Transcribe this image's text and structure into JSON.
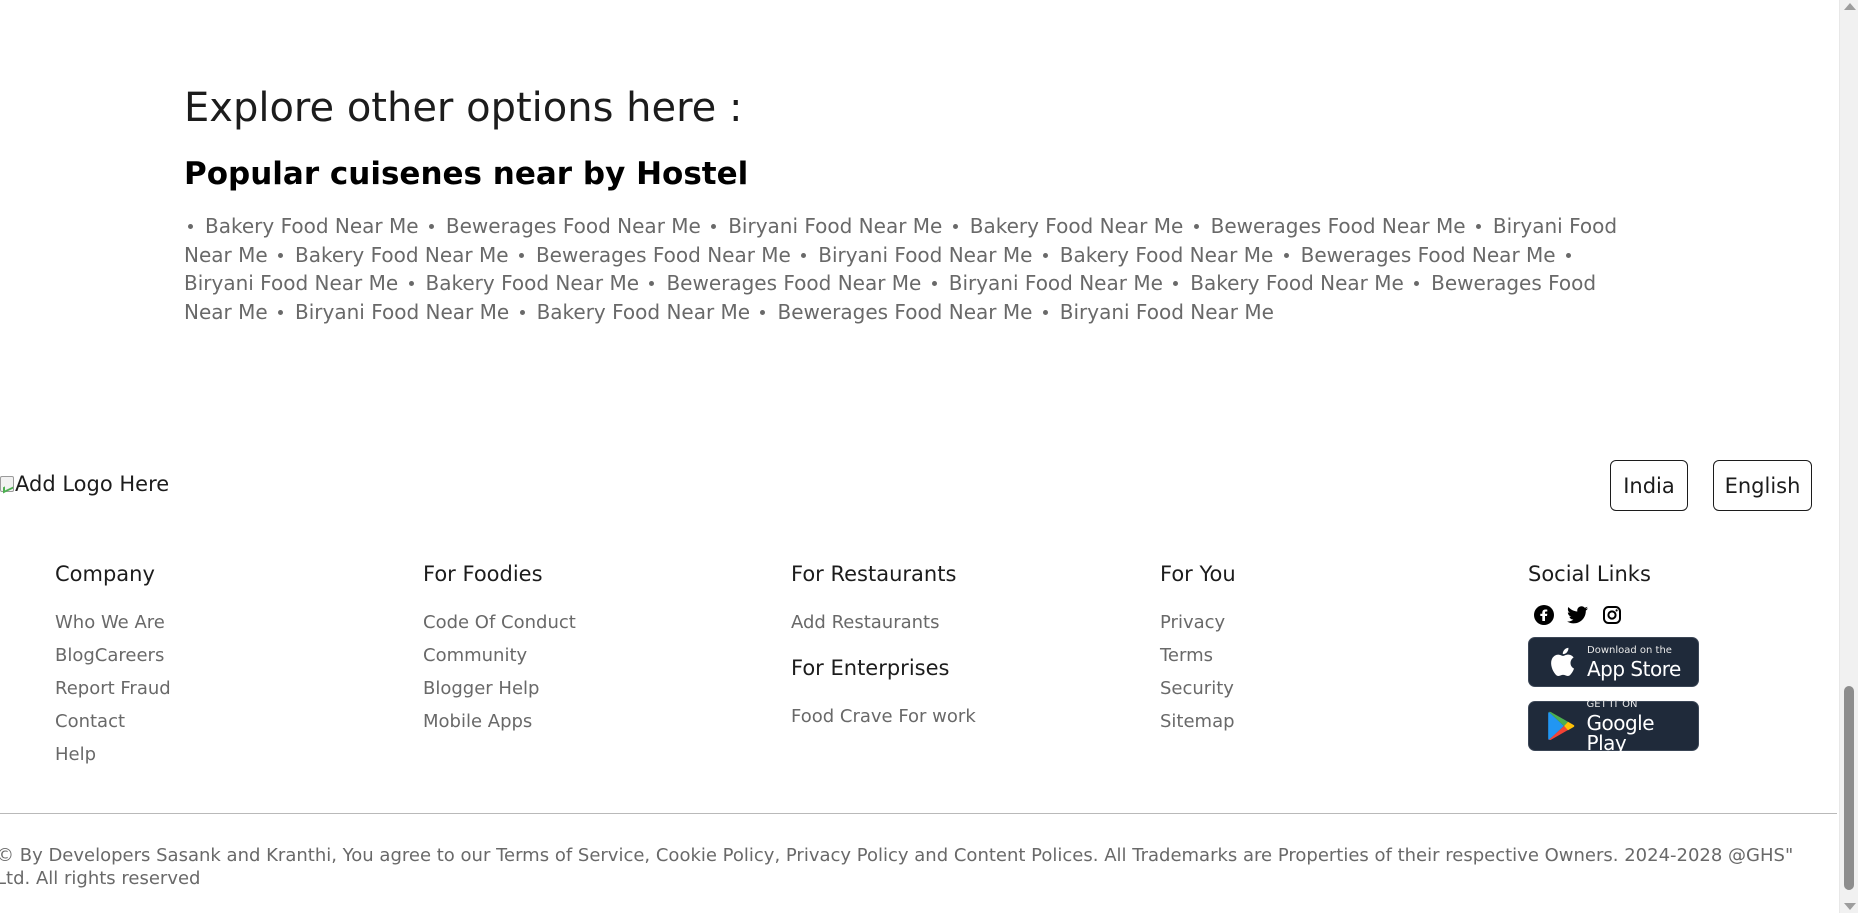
{
  "explore": {
    "title": "Explore other options here :",
    "cuisine_heading": "Popular cuisenes near by Hostel",
    "cuisines": [
      "Bakery Food Near Me",
      "Bewerages Food Near Me",
      "Biryani Food Near Me",
      "Bakery Food Near Me",
      "Bewerages Food Near Me",
      "Biryani Food Near Me",
      "Bakery Food Near Me",
      "Bewerages Food Near Me",
      "Biryani Food Near Me",
      "Bakery Food Near Me",
      "Bewerages Food Near Me",
      "Biryani Food Near Me",
      "Bakery Food Near Me",
      "Bewerages Food Near Me",
      "Biryani Food Near Me",
      "Bakery Food Near Me",
      "Bewerages Food Near Me",
      "Biryani Food Near Me",
      "Bakery Food Near Me",
      "Bewerages Food Near Me",
      "Biryani Food Near Me"
    ]
  },
  "footer": {
    "logo_alt": "Add Logo Here",
    "country": "India",
    "language": "English",
    "company": {
      "heading": "Company",
      "links": [
        "Who We Are",
        "BlogCareers",
        "Report Fraud",
        "Contact",
        "Help"
      ]
    },
    "foodies": {
      "heading": "For Foodies",
      "links": [
        "Code Of Conduct",
        "Community",
        "Blogger Help",
        "Mobile Apps"
      ]
    },
    "restaurants": {
      "heading": "For Restaurants",
      "links": [
        "Add Restaurants"
      ]
    },
    "enterprises": {
      "heading": "For Enterprises",
      "links": [
        "Food Crave For work"
      ]
    },
    "for_you": {
      "heading": "For You",
      "links": [
        "Privacy",
        "Terms",
        "Security",
        "Sitemap"
      ]
    },
    "social": {
      "heading": "Social Links",
      "icons": [
        "facebook-icon",
        "twitter-icon",
        "instagram-icon"
      ],
      "app_store": {
        "small": "Download on the",
        "big": "App Store"
      },
      "google_play": {
        "small": "GET IT ON",
        "big": "Google Play"
      }
    },
    "copyright": "© By Developers Sasank and Kranthi, You agree to our Terms of Service, Cookie Policy, Privacy Policy and Content Polices. All Trademarks are Properties of their respective Owners. 2024-2028 @GHS\" Ltd. All rights reserved"
  },
  "colors": {
    "text": "#1c1c1c",
    "muted": "#696969",
    "badge_bg": "#1f2a3a"
  }
}
